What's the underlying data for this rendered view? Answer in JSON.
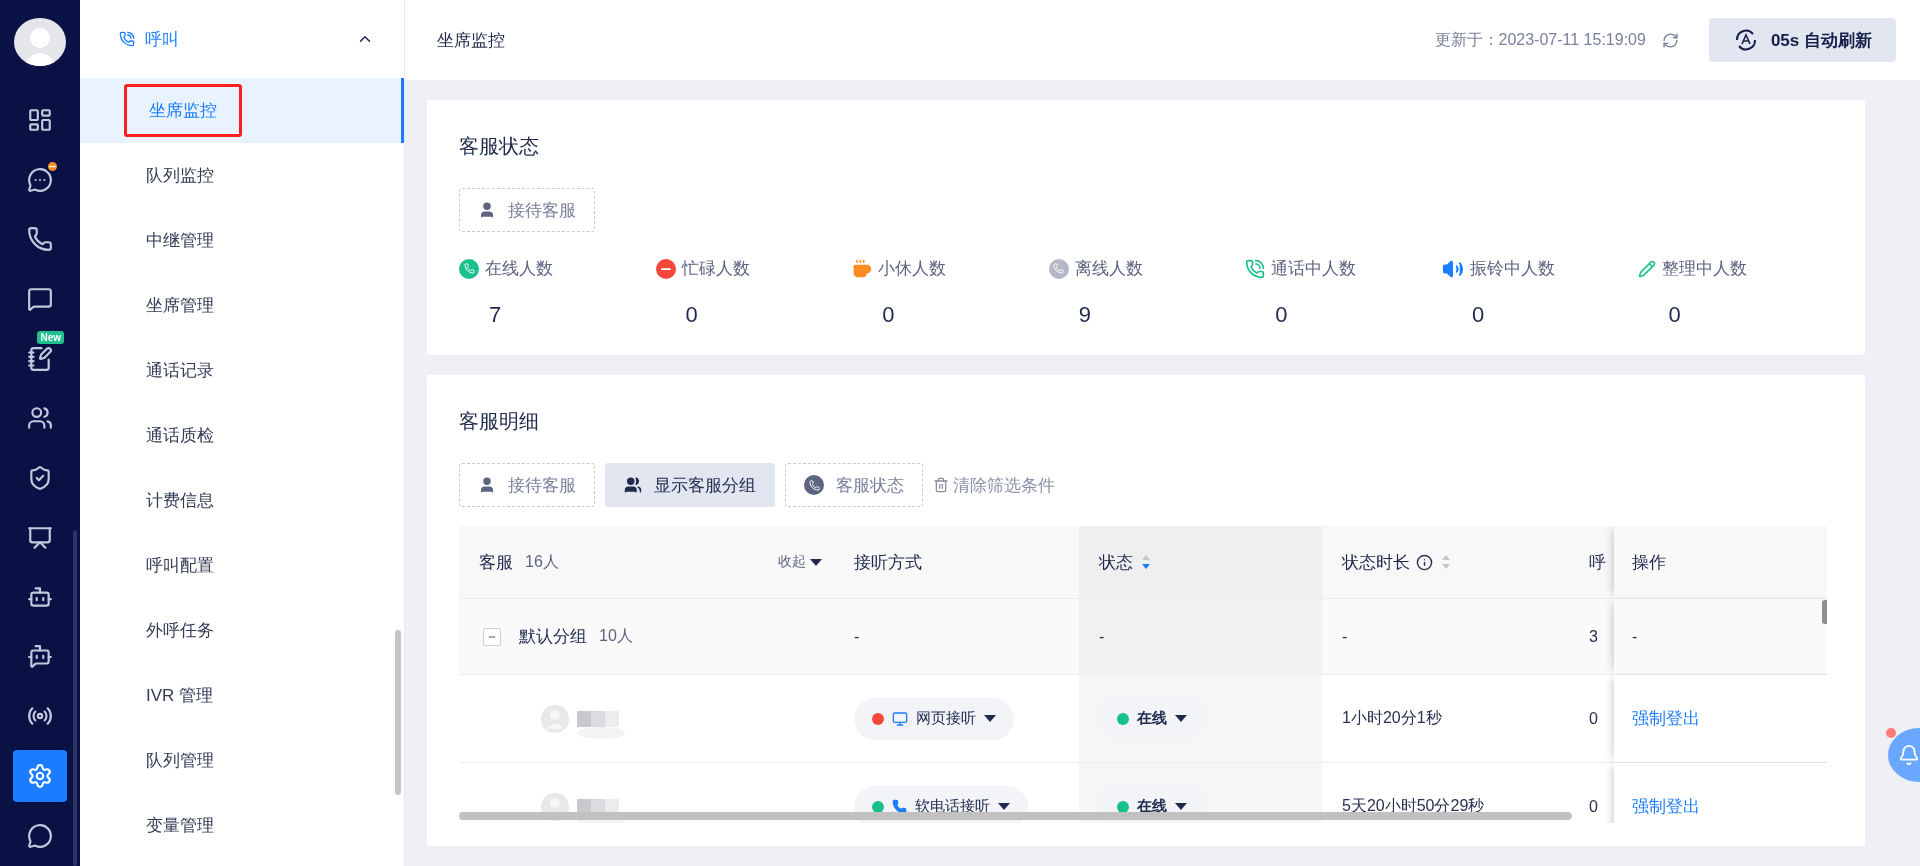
{
  "rail": {
    "items": [
      {
        "kind": "dashboard",
        "selected": false,
        "alert": false
      },
      {
        "kind": "chat",
        "selected": false,
        "alert": true
      },
      {
        "kind": "phone",
        "selected": false,
        "alert": false
      },
      {
        "kind": "message",
        "selected": false,
        "alert": false
      },
      {
        "kind": "notes",
        "selected": false,
        "alert": false,
        "badge": "New"
      },
      {
        "kind": "users",
        "selected": false,
        "alert": false
      },
      {
        "kind": "shield",
        "selected": false,
        "alert": false
      },
      {
        "kind": "monitor",
        "selected": false,
        "alert": false
      },
      {
        "kind": "robot",
        "selected": false,
        "alert": false
      },
      {
        "kind": "robot-mail",
        "selected": false,
        "alert": false
      },
      {
        "kind": "robot-signal",
        "selected": false,
        "alert": false
      },
      {
        "kind": "settings",
        "selected": true,
        "alert": false
      },
      {
        "kind": "whatsapp",
        "selected": false,
        "alert": false
      }
    ]
  },
  "submenu": {
    "group": {
      "label": "呼叫",
      "expanded": true
    },
    "items": [
      {
        "label": "坐席监控",
        "selected": true,
        "annotated": true
      },
      {
        "label": "队列监控",
        "selected": false,
        "annotated": false
      },
      {
        "label": "中继管理",
        "selected": false,
        "annotated": false
      },
      {
        "label": "坐席管理",
        "selected": false,
        "annotated": false
      },
      {
        "label": "通话记录",
        "selected": false,
        "annotated": false
      },
      {
        "label": "通话质检",
        "selected": false,
        "annotated": false
      },
      {
        "label": "计费信息",
        "selected": false,
        "annotated": false
      },
      {
        "label": "呼叫配置",
        "selected": false,
        "annotated": false
      },
      {
        "label": "外呼任务",
        "selected": false,
        "annotated": false
      },
      {
        "label": "IVR 管理",
        "selected": false,
        "annotated": false
      },
      {
        "label": "队列管理",
        "selected": false,
        "annotated": false
      },
      {
        "label": "变量管理",
        "selected": false,
        "annotated": false
      }
    ]
  },
  "header": {
    "title": "坐席监控",
    "updated": "更新于：2023-07-11 15:19:09",
    "auto_refresh": "05s 自动刷新"
  },
  "status_card": {
    "title": "客服状态",
    "filter": "接待客服",
    "stats": [
      {
        "kind": "online",
        "label": "在线人数",
        "value": "7"
      },
      {
        "kind": "busy",
        "label": "忙碌人数",
        "value": "0"
      },
      {
        "kind": "break",
        "label": "小休人数",
        "value": "0"
      },
      {
        "kind": "offline",
        "label": "离线人数",
        "value": "9"
      },
      {
        "kind": "calling",
        "label": "通话中人数",
        "value": "0"
      },
      {
        "kind": "ringing",
        "label": "振铃中人数",
        "value": "0"
      },
      {
        "kind": "wrapup",
        "label": "整理中人数",
        "value": "0"
      }
    ]
  },
  "detail_card": {
    "title": "客服明细",
    "filters": [
      {
        "kind": "agent",
        "label": "接待客服",
        "selected": false
      },
      {
        "kind": "group",
        "label": "显示客服分组",
        "selected": true
      },
      {
        "kind": "status",
        "label": "客服状态",
        "selected": false
      }
    ],
    "clear": "清除筛选条件",
    "table": {
      "columns": [
        {
          "label": "客服",
          "count": "16人",
          "collapse": "收起"
        },
        {
          "label": "接听方式"
        },
        {
          "label": "状态",
          "sorted": true
        },
        {
          "label": "状态时长",
          "info": true,
          "sorted": false
        },
        {
          "label": "呼"
        },
        {
          "label": "操作"
        }
      ],
      "group": {
        "name": "默认分组",
        "count": "10人",
        "expanded": true,
        "cells": [
          "-",
          "-",
          "-",
          "3",
          "-"
        ]
      },
      "rows": [
        {
          "mode": {
            "kind": "web",
            "label": "网页接听",
            "color": "#f5483b"
          },
          "status": {
            "label": "在线",
            "color": "#19c08b"
          },
          "duration": "1小时20分1秒",
          "calls": "0",
          "action": "强制登出"
        },
        {
          "mode": {
            "kind": "softphone",
            "label": "软电话接听",
            "color": "#19c08b"
          },
          "status": {
            "label": "在线",
            "color": "#19c08b"
          },
          "duration": "5天20小时50分29秒",
          "calls": "0",
          "action": "强制登出"
        }
      ]
    }
  }
}
